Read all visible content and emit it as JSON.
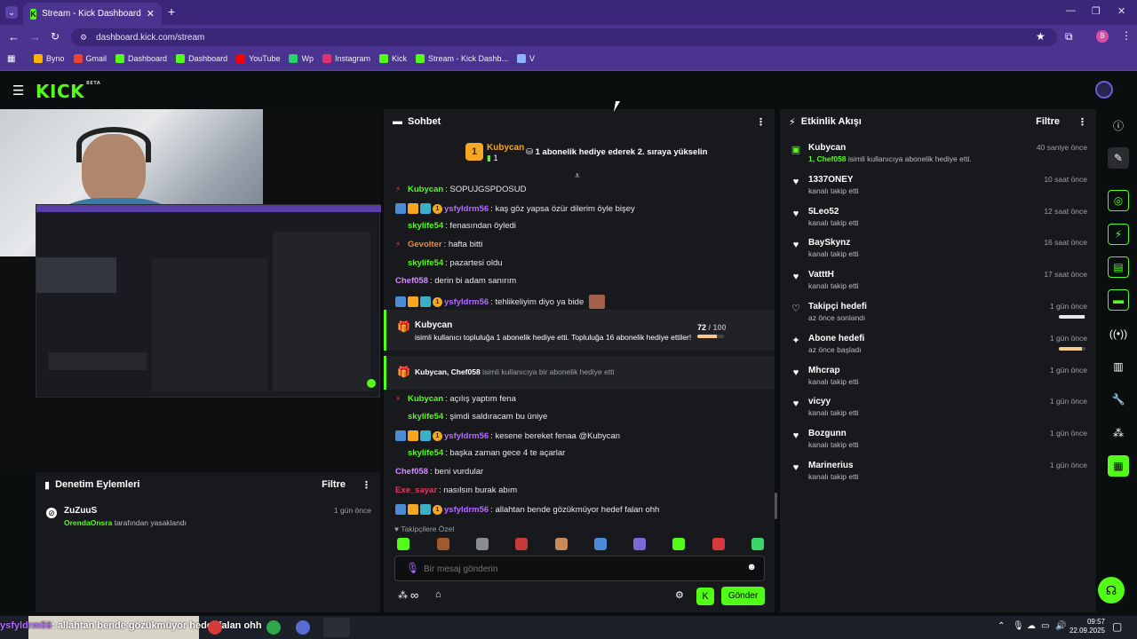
{
  "browser": {
    "tab_title": "Stream - Kick Dashboard",
    "url": "dashboard.kick.com/stream",
    "bookmarks": [
      "Byno",
      "Gmail",
      "Dashboard",
      "Dashboard",
      "YouTube",
      "Wp",
      "Instagram",
      "Kick",
      "Stream - Kick Dashb...",
      "V"
    ],
    "profile_initial": "B"
  },
  "header": {
    "logo": "KICK",
    "logo_beta": "BETA"
  },
  "chat": {
    "title": "Sohbet",
    "pinned_user": "Kubycan",
    "pinned_rank": "1",
    "pinned_count": "1",
    "pinned_message": "1 abonelik hediye ederek 2. sıraya yükselin",
    "messages": [
      {
        "user": "Kubycan",
        "text": ": SOPUJGSPDOSUD",
        "color": "#53fc18"
      },
      {
        "user": "ysfyldrm56",
        "text": ": kaş göz yapsa özür dilerim öyle bişey",
        "color": "#b36bff"
      },
      {
        "user": "skylife54",
        "text": ": fenasından öyledi",
        "color": "#53fc18"
      },
      {
        "user": "Gevolter",
        "text": ": hafta bitti",
        "color": "#f08a3c"
      },
      {
        "user": "skylife54",
        "text": ": pazartesi oldu",
        "color": "#53fc18"
      },
      {
        "user": "Chef058",
        "text": ": derin bi adam sanırım",
        "color": "#d58cff"
      },
      {
        "user": "ysfyldrm56",
        "text": ": tehlikeliyim diyo ya bide",
        "color": "#b36bff"
      },
      {
        "user": "Kubycan",
        "text": ": açılış yaptım fena",
        "color": "#53fc18"
      },
      {
        "user": "skylife54",
        "text": ": şimdi saldıracam bu üniye",
        "color": "#53fc18"
      },
      {
        "user": "ysfyldrm56",
        "text": ": kesene bereket fenaa @Kubycan",
        "color": "#b36bff"
      },
      {
        "user": "skylife54",
        "text": ": başka zaman gece 4 te açarlar",
        "color": "#53fc18"
      },
      {
        "user": "Chef058",
        "text": ": beni vurdular",
        "color": "#d58cff"
      },
      {
        "user": "Exe_sayar",
        "text": ": nasılsın burak abım",
        "color": "#e8375f"
      },
      {
        "user": "ysfyldrm56",
        "text": ": allahtan bende gözükmüyor hedef falan ohh",
        "color": "#b36bff"
      }
    ],
    "gift1": {
      "user": "Kubycan",
      "text": "isimli kullanıcı topluluğa 1 abonelik hediye etti. Topluluğa 16 abonelik hediye ettiler!",
      "progress": "72",
      "goal": "/ 100"
    },
    "gift2": {
      "users": "Kubycan, Chef058",
      "text": "isimli kullanıcıya bir abonelik hediye etti"
    },
    "followers_label": "Takipçilere Özel",
    "input_placeholder": "Bir mesaj gönderin",
    "send_label": "Gönder",
    "infinity": "∞"
  },
  "moderation": {
    "title": "Denetim Eylemleri",
    "filter": "Filtre",
    "user": "ZuZuuS",
    "by": "OrendaOnsra",
    "action": "tarafından yasaklandı",
    "time": "1 gün önce"
  },
  "activity": {
    "title": "Etkinlik Akışı",
    "filter": "Filtre",
    "items": [
      {
        "name": "Kubycan",
        "sub_hl": "1, Chef058",
        "sub": "isimli kullanıcıya abonelik hediye etti.",
        "time": "40 saniye önce",
        "icon": "gift-icon"
      },
      {
        "name": "1337ONEY",
        "sub": "kanalı takip etti",
        "time": "10 saat önce",
        "icon": "heart-icon"
      },
      {
        "name": "5Leo52",
        "sub": "kanalı takip etti",
        "time": "12 saat önce",
        "icon": "heart-icon"
      },
      {
        "name": "BaySkynz",
        "sub": "kanalı takip etti",
        "time": "16 saat önce",
        "icon": "heart-icon"
      },
      {
        "name": "VatttH",
        "sub": "kanalı takip etti",
        "time": "17 saat önce",
        "icon": "heart-icon"
      },
      {
        "name": "Takipçi hedefi",
        "sub": "az önce sonlandı",
        "time": "1 gün önce",
        "icon": "heart-outline-icon",
        "progress": 0.95,
        "bar_color": "#e8e8e8"
      },
      {
        "name": "Abone hedefi",
        "sub": "az önce başladı",
        "time": "1 gün önce",
        "icon": "star-icon",
        "progress": 0.85,
        "bar_color": "#f5c98a"
      },
      {
        "name": "Mhcrap",
        "sub": "kanalı takip etti",
        "time": "1 gün önce",
        "icon": "heart-icon"
      },
      {
        "name": "vicyy",
        "sub": "kanalı takip etti",
        "time": "1 gün önce",
        "icon": "heart-icon"
      },
      {
        "name": "Bozgunn",
        "sub": "kanalı takip etti",
        "time": "1 gün önce",
        "icon": "heart-icon"
      },
      {
        "name": "Marinerius",
        "sub": "kanalı takip etti",
        "time": "1 gün önce",
        "icon": "heart-icon"
      }
    ]
  },
  "taskbar": {
    "overlay_user": "ysfyldrm56",
    "overlay_text": ": allahtan bende gözükmüyor hedef falan ohh",
    "time": "09:57",
    "date": "22.09.2025"
  }
}
